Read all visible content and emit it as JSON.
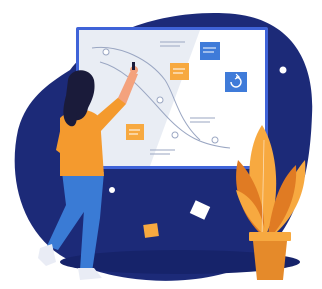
{
  "illustration": {
    "subject": "woman-drawing-on-whiteboard",
    "icons": [
      "whiteboard-icon",
      "sticky-note-icon",
      "plant-icon",
      "refresh-icon",
      "sparkle-icon"
    ]
  },
  "colors": {
    "background_blob": "#1c2a78",
    "floor_shadow": "#16236a",
    "board_frame": "#3f63d8",
    "board_surface": "#ffffff",
    "board_shade": "#e7ebf3",
    "board_lines": "#9aa6c2",
    "note_orange": "#f7a940",
    "note_blue": "#3f7bd9",
    "shirt": "#f49a2e",
    "pants": "#3a7bd5",
    "hair": "#1a1b3a",
    "skin": "#f4a27d",
    "shoes": "#e9ecf5",
    "leaf_light": "#f7a940",
    "leaf_dark": "#e07b23",
    "pot": "#f7a940",
    "pot_shade": "#e58a2a"
  }
}
